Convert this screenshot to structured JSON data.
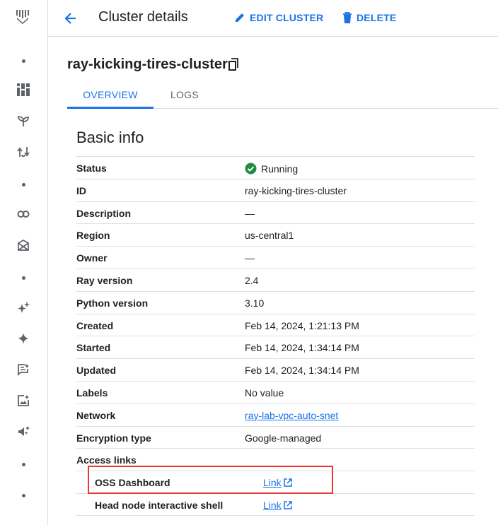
{
  "header": {
    "title": "Cluster details",
    "edit_label": "EDIT CLUSTER",
    "delete_label": "DELETE"
  },
  "cluster": {
    "name": "ray-kicking-tires-cluster"
  },
  "tabs": [
    {
      "label": "OVERVIEW",
      "active": true
    },
    {
      "label": "LOGS",
      "active": false
    }
  ],
  "basic_info": {
    "title": "Basic info",
    "rows": [
      {
        "key": "Status",
        "value": "Running"
      },
      {
        "key": "ID",
        "value": "ray-kicking-tires-cluster"
      },
      {
        "key": "Description",
        "value": "—"
      },
      {
        "key": "Region",
        "value": "us-central1"
      },
      {
        "key": "Owner",
        "value": "—"
      },
      {
        "key": "Ray version",
        "value": "2.4"
      },
      {
        "key": "Python version",
        "value": "3.10"
      },
      {
        "key": "Created",
        "value": "Feb 14, 2024, 1:21:13 PM"
      },
      {
        "key": "Started",
        "value": "Feb 14, 2024, 1:34:14 PM"
      },
      {
        "key": "Updated",
        "value": "Feb 14, 2024, 1:34:14 PM"
      },
      {
        "key": "Labels",
        "value": "No value"
      },
      {
        "key": "Network",
        "value": "ray-lab-vpc-auto-snet"
      },
      {
        "key": "Encryption type",
        "value": "Google-managed"
      },
      {
        "key": "Access links",
        "value": ""
      }
    ],
    "access_links": [
      {
        "key": "OSS Dashboard",
        "value": "Link"
      },
      {
        "key": "Head node interactive shell",
        "value": "Link"
      }
    ]
  },
  "colors": {
    "accent": "#1a73e8",
    "status_ok": "#1e8e3e",
    "highlight": "#e53935"
  }
}
